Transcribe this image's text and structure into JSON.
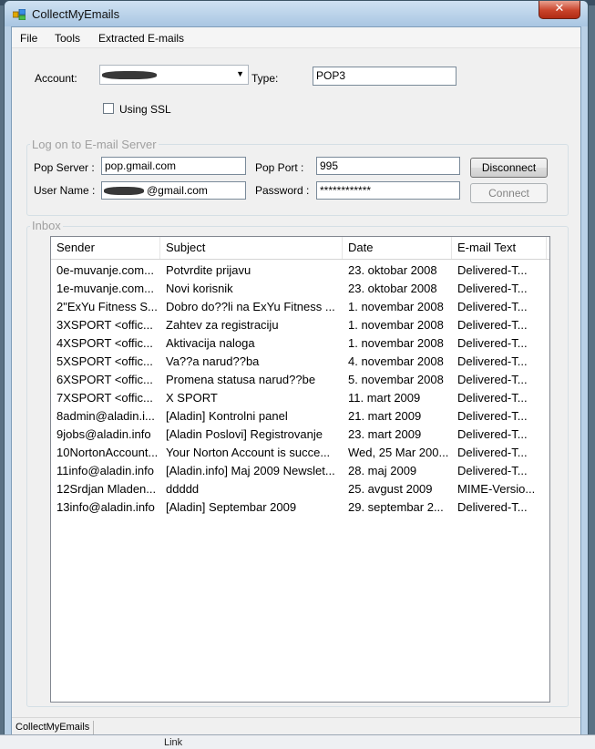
{
  "window": {
    "title": "CollectMyEmails",
    "close_glyph": "✕"
  },
  "menu": [
    "File",
    "Tools",
    "Extracted E-mails"
  ],
  "account": {
    "label": "Account:",
    "type_label": "Type:",
    "type_value": "POP3",
    "ssl_label": "Using SSL",
    "ssl_checked": false
  },
  "server": {
    "group_title": "Log on to E-mail Server",
    "pop_server_label": "Pop Server :",
    "pop_server_value": "pop.gmail.com",
    "pop_port_label": "Pop Port :",
    "pop_port_value": "995",
    "user_name_label": "User Name :",
    "user_name_value": "@gmail.com",
    "password_label": "Password :",
    "password_value": "************",
    "disconnect_label": "Disconnect",
    "connect_label": "Connect"
  },
  "inbox": {
    "group_title": "Inbox",
    "columns": [
      "Sender",
      "Subject",
      "Date",
      "E-mail Text"
    ],
    "rows": [
      [
        "0e-muvanje.com...",
        "Potvrdite prijavu",
        "23. oktobar 2008",
        "Delivered-T..."
      ],
      [
        "1e-muvanje.com...",
        "Novi korisnik",
        "23. oktobar 2008",
        "Delivered-T..."
      ],
      [
        "2\"ExYu Fitness S...",
        "Dobro do??li na ExYu Fitness ...",
        "1. novembar 2008",
        "Delivered-T..."
      ],
      [
        "3XSPORT <offic...",
        "Zahtev za registraciju",
        "1. novembar 2008",
        "Delivered-T..."
      ],
      [
        "4XSPORT <offic...",
        "Aktivacija naloga",
        "1. novembar 2008",
        "Delivered-T..."
      ],
      [
        "5XSPORT <offic...",
        "Va??a narud??ba",
        "4. novembar 2008",
        "Delivered-T..."
      ],
      [
        "6XSPORT <offic...",
        "Promena statusa narud??be",
        "5. novembar 2008",
        "Delivered-T..."
      ],
      [
        "7XSPORT <offic...",
        "X SPORT",
        "11. mart 2009",
        "Delivered-T..."
      ],
      [
        "8admin@aladin.i...",
        "[Aladin] Kontrolni panel",
        "21. mart 2009",
        "Delivered-T..."
      ],
      [
        "9jobs@aladin.info",
        "[Aladin Poslovi] Registrovanje",
        "23. mart 2009",
        "Delivered-T..."
      ],
      [
        "10NortonAccount...",
        "Your Norton Account is succe...",
        "Wed, 25 Mar 200...",
        "Delivered-T..."
      ],
      [
        "11info@aladin.info",
        "[Aladin.info] Maj 2009 Newslet...",
        "28. maj 2009",
        "Delivered-T..."
      ],
      [
        "12Srdjan Mladen...",
        "ddddd",
        "25. avgust 2009",
        "MIME-Versio..."
      ],
      [
        "13info@aladin.info",
        "[Aladin] Septembar 2009",
        "29. septembar 2...",
        "Delivered-T..."
      ]
    ]
  },
  "status": {
    "text": "CollectMyEmails"
  },
  "background": {
    "taskbar_text": "Link"
  }
}
